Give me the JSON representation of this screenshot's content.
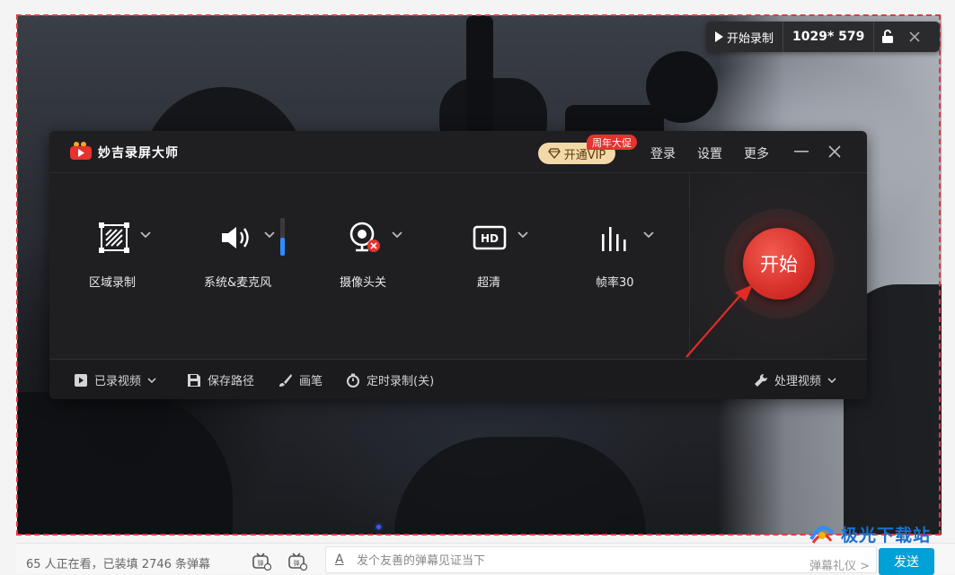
{
  "recorder_toolbar": {
    "start_label": "开始录制",
    "size": "1029* 579"
  },
  "app": {
    "title": "妙吉录屏大师",
    "vip_label": "开通VIP",
    "vip_badge": "周年大促",
    "login": "登录",
    "settings": "设置",
    "more": "更多",
    "tools": [
      {
        "label": "区域录制",
        "icon": "area-select-icon"
      },
      {
        "label": "系统&麦克风",
        "icon": "speaker-icon"
      },
      {
        "label": "摄像头关",
        "icon": "camera-off-icon"
      },
      {
        "label": "超清",
        "icon": "hd-icon"
      },
      {
        "label": "帧率30",
        "icon": "bars-icon"
      }
    ],
    "start_button": "开始",
    "bottom": {
      "recorded_videos": "已录视频",
      "save_path": "保存路径",
      "pen": "画笔",
      "timer": "定时录制(关)",
      "process_video": "处理视频"
    }
  },
  "page_bottom": {
    "viewer_count": "65 人正在看，已装填 2746 条弹幕",
    "danmaku_placeholder": "发个友善的弹幕见证当下",
    "etiquette": "弹幕礼仪 >",
    "send": "发送"
  },
  "watermark": {
    "text": "极光下载站"
  },
  "colors": {
    "accent_red": "#e7322d",
    "selection_border": "#e5393a",
    "send_blue": "#00a1d6",
    "vip_gold": "#f3d9a8",
    "volume_blue": "#2f8cff"
  }
}
